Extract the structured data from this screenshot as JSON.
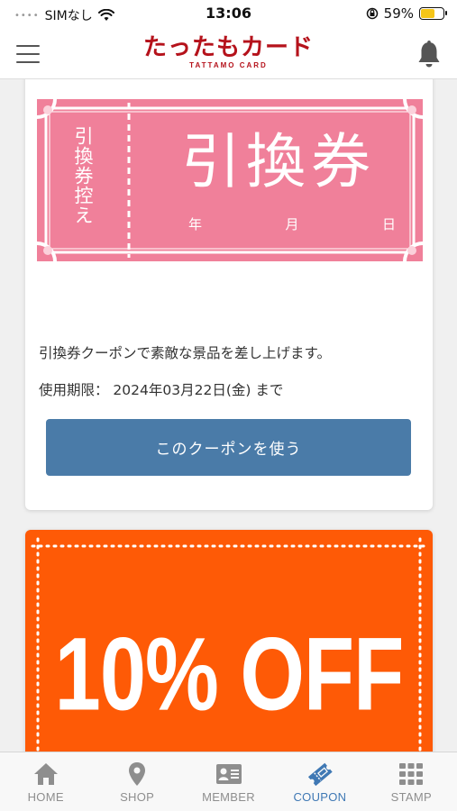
{
  "status_bar": {
    "carrier": "SIMなし",
    "time": "13:06",
    "battery": "59%"
  },
  "header": {
    "logo_main": "たったもカード",
    "logo_sub": "TATTAMO CARD",
    "icons": [
      "menu-icon",
      "bell-icon"
    ]
  },
  "coupon1": {
    "ticket_stub": "引換券控え",
    "ticket_title": "引換券",
    "date_year": "年",
    "date_month": "月",
    "date_day": "日",
    "description": "引換券クーポンで素敵な景品を差し上げます。",
    "expiry": "使用期限： 2024年03月22日(金) まで",
    "button_label": "このクーポンを使う"
  },
  "coupon2": {
    "title": "10% OFF"
  },
  "bottom_nav": {
    "items": [
      {
        "label": "HOME",
        "icon": "home-icon"
      },
      {
        "label": "SHOP",
        "icon": "map-pin-icon"
      },
      {
        "label": "MEMBER",
        "icon": "member-card-icon"
      },
      {
        "label": "COUPON",
        "icon": "ticket-icon"
      },
      {
        "label": "STAMP",
        "icon": "grid-icon"
      }
    ],
    "active": "COUPON"
  },
  "colors": {
    "brand": "#b5121b",
    "ticket_pink": "#f0809a",
    "button_blue": "#4a7ba8",
    "coupon_orange": "#fe5a06",
    "nav_active": "#3f78b4"
  }
}
